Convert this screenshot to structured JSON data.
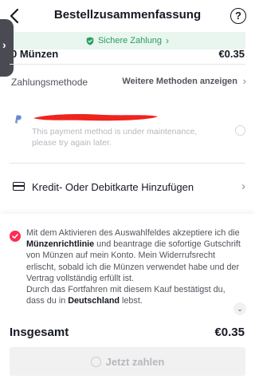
{
  "header": {
    "title": "Bestellzusammenfassung",
    "help_glyph": "?"
  },
  "secure_banner": {
    "text": "Sichere Zahlung",
    "chevron": "›",
    "color": "#2a9d5c"
  },
  "order_item": {
    "label": "0 Münzen",
    "price": "€0.35"
  },
  "side_tab": {
    "chevron": "›"
  },
  "payment_method": {
    "label": "Zahlungsmethode",
    "more_link": "Weitere Methoden anzeigen",
    "chevron": "›"
  },
  "paypal": {
    "icon": "paypal-icon",
    "maintenance_text": "This payment method is under maintenance, please try again later."
  },
  "card": {
    "icon": "credit-card-icon",
    "label": "Kredit- Oder Debitkarte Hinzufügen",
    "chevron": "›"
  },
  "consent": {
    "part1": "Mit dem Aktivieren des Auswahlfeldes akzeptiere ich die ",
    "link": "Münzenrichtlinie",
    "part2": " und beantrage die sofortige Gutschrift von Münzen auf mein Konto. Mein Widerrufsrecht erlischt, sobald ich die Münzen verwendet habe und der Vertrag vollständig erfüllt ist.",
    "part3": "Durch das Fortfahren mit diesem Kauf bestätigst du, dass du in ",
    "country": "Deutschland",
    "part4": " lebst.",
    "checked": true,
    "accent": "#fe2c55"
  },
  "scroll_hint": {
    "glyph": "⌄"
  },
  "total": {
    "label": "Insgesamt",
    "value": "€0.35"
  },
  "pay_button": {
    "label": "Jetzt zahlen",
    "enabled": false
  }
}
